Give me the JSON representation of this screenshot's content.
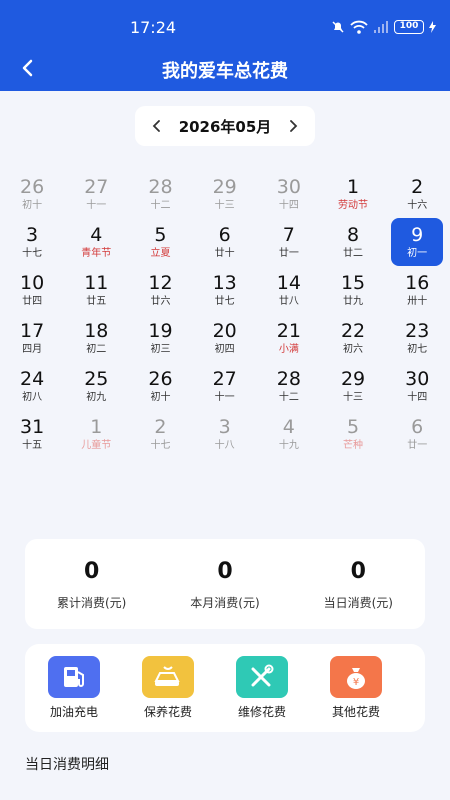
{
  "status_bar": {
    "time": "17:24",
    "battery": "100"
  },
  "header": {
    "title": "我的爱车总花费"
  },
  "month_selector": {
    "label": "2026年05月"
  },
  "calendar": {
    "weeks": [
      [
        {
          "day": "26",
          "sub": "初十",
          "other": true,
          "festival": false
        },
        {
          "day": "27",
          "sub": "十一",
          "other": true,
          "festival": false
        },
        {
          "day": "28",
          "sub": "十二",
          "other": true,
          "festival": false
        },
        {
          "day": "29",
          "sub": "十三",
          "other": true,
          "festival": false
        },
        {
          "day": "30",
          "sub": "十四",
          "other": true,
          "festival": false
        },
        {
          "day": "1",
          "sub": "劳动节",
          "other": false,
          "festival": true
        },
        {
          "day": "2",
          "sub": "十六",
          "other": false,
          "festival": false
        }
      ],
      [
        {
          "day": "3",
          "sub": "十七",
          "other": false,
          "festival": false
        },
        {
          "day": "4",
          "sub": "青年节",
          "other": false,
          "festival": true
        },
        {
          "day": "5",
          "sub": "立夏",
          "other": false,
          "festival": true
        },
        {
          "day": "6",
          "sub": "廿十",
          "other": false,
          "festival": false
        },
        {
          "day": "7",
          "sub": "廿一",
          "other": false,
          "festival": false
        },
        {
          "day": "8",
          "sub": "廿二",
          "other": false,
          "festival": false
        },
        {
          "day": "9",
          "sub": "初一",
          "other": false,
          "festival": false,
          "selected": true
        }
      ],
      [
        {
          "day": "10",
          "sub": "廿四",
          "other": false,
          "festival": false
        },
        {
          "day": "11",
          "sub": "廿五",
          "other": false,
          "festival": false
        },
        {
          "day": "12",
          "sub": "廿六",
          "other": false,
          "festival": false
        },
        {
          "day": "13",
          "sub": "廿七",
          "other": false,
          "festival": false
        },
        {
          "day": "14",
          "sub": "廿八",
          "other": false,
          "festival": false
        },
        {
          "day": "15",
          "sub": "廿九",
          "other": false,
          "festival": false
        },
        {
          "day": "16",
          "sub": "卅十",
          "other": false,
          "festival": false
        }
      ],
      [
        {
          "day": "17",
          "sub": "四月",
          "other": false,
          "festival": false
        },
        {
          "day": "18",
          "sub": "初二",
          "other": false,
          "festival": false
        },
        {
          "day": "19",
          "sub": "初三",
          "other": false,
          "festival": false
        },
        {
          "day": "20",
          "sub": "初四",
          "other": false,
          "festival": false
        },
        {
          "day": "21",
          "sub": "小满",
          "other": false,
          "festival": true
        },
        {
          "day": "22",
          "sub": "初六",
          "other": false,
          "festival": false
        },
        {
          "day": "23",
          "sub": "初七",
          "other": false,
          "festival": false
        }
      ],
      [
        {
          "day": "24",
          "sub": "初八",
          "other": false,
          "festival": false
        },
        {
          "day": "25",
          "sub": "初九",
          "other": false,
          "festival": false
        },
        {
          "day": "26",
          "sub": "初十",
          "other": false,
          "festival": false
        },
        {
          "day": "27",
          "sub": "十一",
          "other": false,
          "festival": false
        },
        {
          "day": "28",
          "sub": "十二",
          "other": false,
          "festival": false
        },
        {
          "day": "29",
          "sub": "十三",
          "other": false,
          "festival": false
        },
        {
          "day": "30",
          "sub": "十四",
          "other": false,
          "festival": false
        }
      ],
      [
        {
          "day": "31",
          "sub": "十五",
          "other": false,
          "festival": false
        },
        {
          "day": "1",
          "sub": "儿童节",
          "other": true,
          "festival": true
        },
        {
          "day": "2",
          "sub": "十七",
          "other": true,
          "festival": false
        },
        {
          "day": "3",
          "sub": "十八",
          "other": true,
          "festival": false
        },
        {
          "day": "4",
          "sub": "十九",
          "other": true,
          "festival": false
        },
        {
          "day": "5",
          "sub": "芒种",
          "other": true,
          "festival": true
        },
        {
          "day": "6",
          "sub": "廿一",
          "other": true,
          "festival": false
        }
      ]
    ]
  },
  "stats": [
    {
      "value": "0",
      "label": "累计消费(元)"
    },
    {
      "value": "0",
      "label": "本月消费(元)"
    },
    {
      "value": "0",
      "label": "当日消费(元)"
    }
  ],
  "categories": [
    {
      "label": "加油充电",
      "icon": "fuel-pump-icon",
      "color": "#4f6ff0"
    },
    {
      "label": "保养花费",
      "icon": "car-wash-icon",
      "color": "#f2c23e"
    },
    {
      "label": "维修花费",
      "icon": "wrench-screwdriver-icon",
      "color": "#2fc9b5"
    },
    {
      "label": "其他花费",
      "icon": "money-bag-icon",
      "color": "#f4764a"
    }
  ],
  "detail_section": {
    "title": "当日消费明细"
  },
  "colors": {
    "primary": "#1f5ae0",
    "festival": "#d33a3a",
    "background": "#f3f5fb"
  }
}
